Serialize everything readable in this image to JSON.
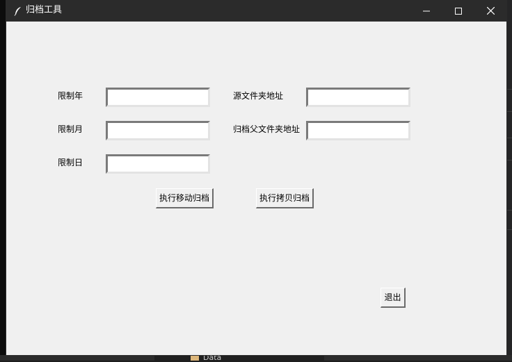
{
  "window": {
    "title": "归档工具"
  },
  "form": {
    "year_label": "限制年",
    "month_label": "限制月",
    "day_label": "限制日",
    "source_label": "源文件夹地址",
    "archive_parent_label": "归档父文件夹地址",
    "year_value": "",
    "month_value": "",
    "day_value": "",
    "source_value": "",
    "archive_parent_value": ""
  },
  "actions": {
    "move_archive": "执行移动归档",
    "copy_archive": "执行拷贝归档",
    "exit": "退出"
  },
  "background": {
    "folder_name": "Data"
  },
  "colors": {
    "titlebar": "#2b2b2b",
    "client": "#f0f0f0",
    "entry_bg": "#ffffff"
  }
}
